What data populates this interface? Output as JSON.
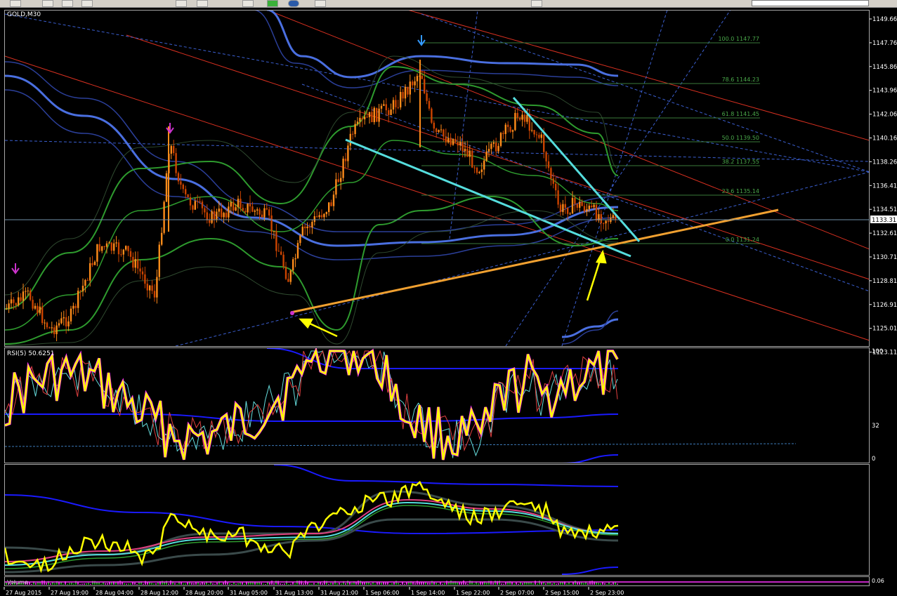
{
  "toolbar": {
    "icons": [
      "new-chart-icon",
      "open-icon",
      "save-icon",
      "print-icon",
      "line-tool-icon",
      "trend-tool-icon",
      "crosshair-icon",
      "zoom-icon",
      "indicator-add-icon",
      "autoscroll-icon",
      "chart-shift-icon"
    ]
  },
  "main_chart": {
    "label": "GOLD,M30",
    "current_price": "1133.31",
    "y_ticks": [
      "1149.66",
      "1147.76",
      "1145.86",
      "1143.96",
      "1142.06",
      "1140.16",
      "1138.26",
      "1136.41",
      "1134.51",
      "1132.61",
      "1130.71",
      "1128.81",
      "1126.91",
      "1125.01",
      "1123.11"
    ],
    "fib_levels": [
      "100.0 1147.77",
      "78.6 1144.23",
      "61.8 1141.45",
      "50.0 1139.50",
      "38.2 1137.55",
      "23.6 1135.14",
      "0.0 1131.24"
    ]
  },
  "rsi_panel": {
    "label": "RSI(5) 50.6251",
    "y_ticks": [
      "100",
      "32",
      "0"
    ]
  },
  "third_panel": {
    "y_ticks": [
      "0.06"
    ]
  },
  "volume_strip": {
    "label": "Volume",
    "y_ticks": [
      "0.06"
    ]
  },
  "time_axis": [
    "27 Aug 2015",
    "27 Aug 19:00",
    "28 Aug 04:00",
    "28 Aug 12:00",
    "28 Aug 20:00",
    "31 Aug 05:00",
    "31 Aug 13:00",
    "31 Aug 21:00",
    "1 Sep 06:00",
    "1 Sep 14:00",
    "1 Sep 22:00",
    "2 Sep 07:00",
    "2 Sep 15:00",
    "2 Sep 23:00"
  ],
  "colors": {
    "background": "#000000",
    "bull_candle": "#ff8c1a",
    "bear_candle": "#cc4400",
    "envelope_blue": "#3355cc",
    "bollinger_green": "#2e9b2e",
    "trend_orange": "#f0a030",
    "trend_cyan": "#55dddd",
    "channel_red": "#d83020",
    "arrow_yellow": "#ffff00",
    "rsi_yellow": "#ffff00",
    "rsi_magenta": "#ff33ff",
    "fib_green": "#3a7a3a"
  },
  "chart_data": {
    "type": "line",
    "title": "GOLD,M30",
    "series": [
      {
        "name": "RSI(5)",
        "values": [
          50.6251
        ]
      }
    ]
  }
}
